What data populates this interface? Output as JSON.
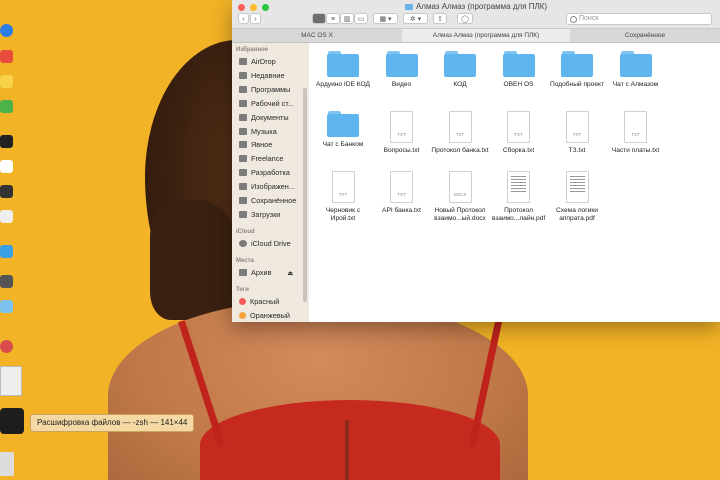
{
  "window": {
    "title": "Алмаз Алмаз (программа для ПЛК)",
    "search_placeholder": "Поиск"
  },
  "tabs": [
    {
      "label": "MAC OS X"
    },
    {
      "label": "Алмаз Алмаз (программа для ПЛК)"
    },
    {
      "label": "Сохранённое"
    }
  ],
  "sidebar": {
    "favorites_header": "Избранное",
    "favorites": [
      {
        "label": "AirDrop",
        "icon": "airdrop-icon"
      },
      {
        "label": "Недавние",
        "icon": "clock-icon"
      },
      {
        "label": "Программы",
        "icon": "apps-icon"
      },
      {
        "label": "Рабочий ст...",
        "icon": "desktop-icon"
      },
      {
        "label": "Документы",
        "icon": "document-icon"
      },
      {
        "label": "Музыка",
        "icon": "music-icon"
      },
      {
        "label": "Явное",
        "icon": "folder-icon"
      },
      {
        "label": "Freelance",
        "icon": "folder-icon"
      },
      {
        "label": "Разработка",
        "icon": "folder-icon"
      },
      {
        "label": "Изображен...",
        "icon": "camera-icon"
      },
      {
        "label": "Сохранённое",
        "icon": "folder-icon"
      },
      {
        "label": "Загрузки",
        "icon": "download-icon"
      }
    ],
    "icloud_header": "iCloud",
    "icloud": [
      {
        "label": "iCloud Drive",
        "icon": "cloud-icon"
      }
    ],
    "places_header": "Места",
    "places": [
      {
        "label": "Архив",
        "icon": "disk-icon"
      }
    ],
    "tags_header": "Теги",
    "tags": [
      {
        "label": "Красный",
        "color": "#fa5a55"
      },
      {
        "label": "Оранжевый",
        "color": "#f9a33b"
      }
    ]
  },
  "files": [
    {
      "name": "Ардуино IDE КОД",
      "kind": "folder"
    },
    {
      "name": "Видео",
      "kind": "folder"
    },
    {
      "name": "КОД",
      "kind": "folder"
    },
    {
      "name": "ОВЕН OS",
      "kind": "folder"
    },
    {
      "name": "Подобный проект",
      "kind": "folder"
    },
    {
      "name": "Чат с Алмазом",
      "kind": "folder"
    },
    {
      "name": "Чат с Банком",
      "kind": "folder"
    },
    {
      "name": "Вопросы.txt",
      "kind": "txt",
      "tag": "TXT"
    },
    {
      "name": "Протокол банка.txt",
      "kind": "txt",
      "tag": "TXT"
    },
    {
      "name": "Сборка.txt",
      "kind": "txt",
      "tag": "TXT"
    },
    {
      "name": "ТЗ.txt",
      "kind": "txt",
      "tag": "TXT"
    },
    {
      "name": "Части платы.txt",
      "kind": "txt",
      "tag": "TXT"
    },
    {
      "name": "Черновик с Ирой.txt",
      "kind": "txt",
      "tag": "TXT"
    },
    {
      "name": "API банка.txt",
      "kind": "txt",
      "tag": "TXT"
    },
    {
      "name": "Новый Протокол взаимо...ый.docx",
      "kind": "txt",
      "tag": "DOCX"
    },
    {
      "name": "Протокол взаимо...лайн.pdf",
      "kind": "pdf",
      "tag": ""
    },
    {
      "name": "Схема логики аппрата.pdf",
      "kind": "pdf",
      "tag": ""
    }
  ],
  "terminal_tooltip": "Расшифровка файлов — -zsh — 141×44"
}
